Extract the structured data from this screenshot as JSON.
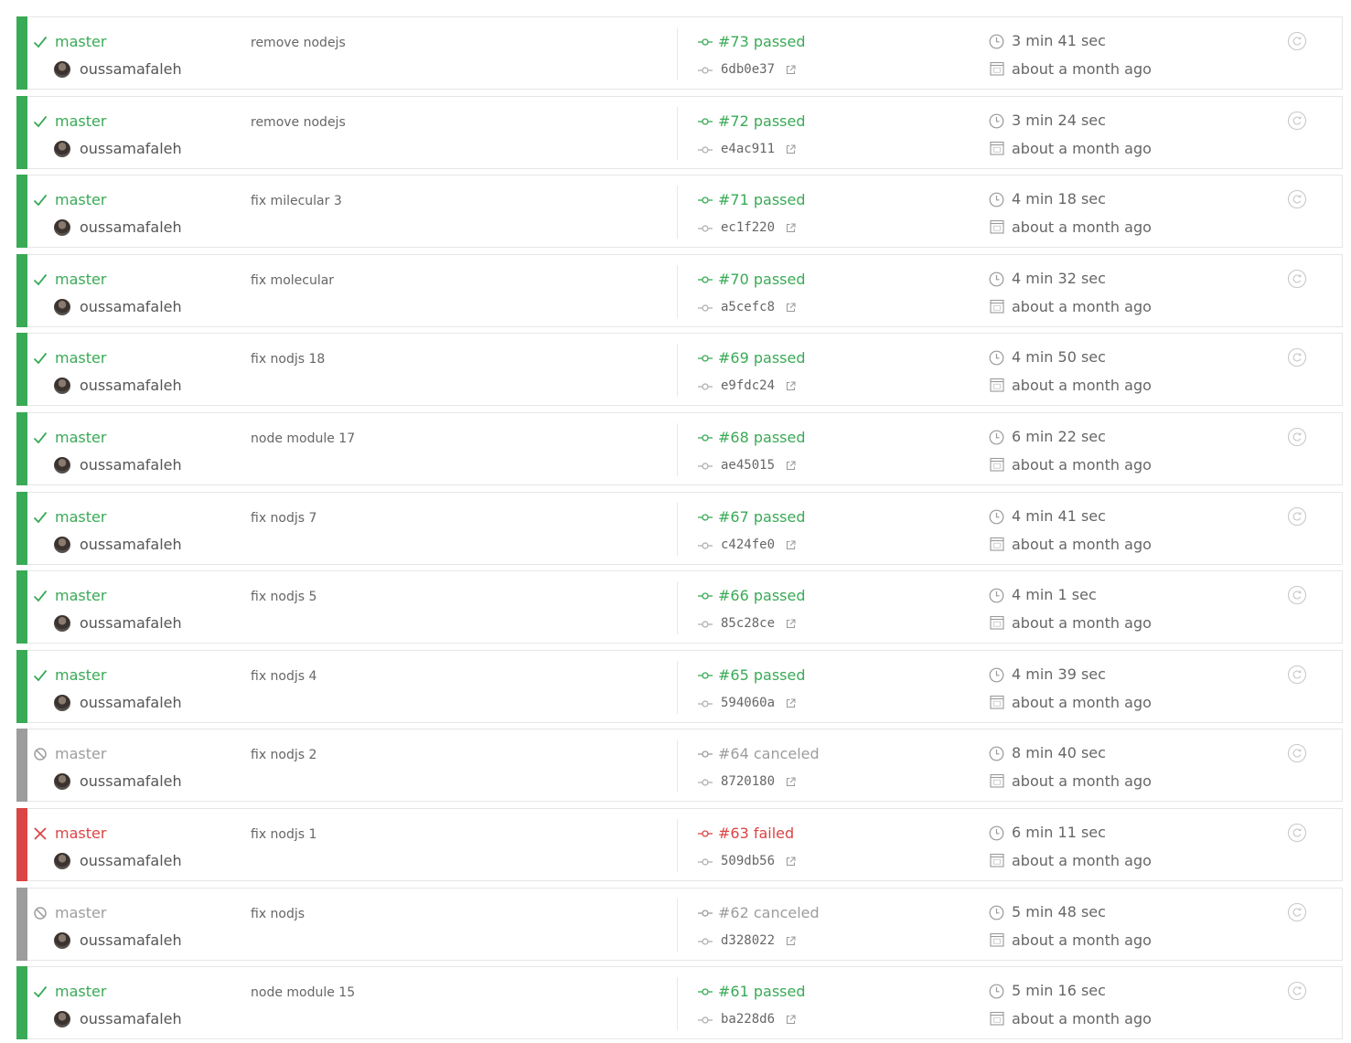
{
  "colors": {
    "passed": "#39aa56",
    "failed": "#db4545",
    "canceled": "#9d9d9d"
  },
  "builds": [
    {
      "state": "passed",
      "branch": "master",
      "author": "oussamafaleh",
      "message": "remove nodejs",
      "build": "#73 passed",
      "sha": "6db0e37",
      "duration": "3 min 41 sec",
      "finished": "about a month ago"
    },
    {
      "state": "passed",
      "branch": "master",
      "author": "oussamafaleh",
      "message": "remove nodejs",
      "build": "#72 passed",
      "sha": "e4ac911",
      "duration": "3 min 24 sec",
      "finished": "about a month ago"
    },
    {
      "state": "passed",
      "branch": "master",
      "author": "oussamafaleh",
      "message": "fix milecular 3",
      "build": "#71 passed",
      "sha": "ec1f220",
      "duration": "4 min 18 sec",
      "finished": "about a month ago"
    },
    {
      "state": "passed",
      "branch": "master",
      "author": "oussamafaleh",
      "message": "fix molecular",
      "build": "#70 passed",
      "sha": "a5cefc8",
      "duration": "4 min 32 sec",
      "finished": "about a month ago"
    },
    {
      "state": "passed",
      "branch": "master",
      "author": "oussamafaleh",
      "message": "fix nodjs 18",
      "build": "#69 passed",
      "sha": "e9fdc24",
      "duration": "4 min 50 sec",
      "finished": "about a month ago"
    },
    {
      "state": "passed",
      "branch": "master",
      "author": "oussamafaleh",
      "message": "node module 17",
      "build": "#68 passed",
      "sha": "ae45015",
      "duration": "6 min 22 sec",
      "finished": "about a month ago"
    },
    {
      "state": "passed",
      "branch": "master",
      "author": "oussamafaleh",
      "message": "fix nodjs 7",
      "build": "#67 passed",
      "sha": "c424fe0",
      "duration": "4 min 41 sec",
      "finished": "about a month ago"
    },
    {
      "state": "passed",
      "branch": "master",
      "author": "oussamafaleh",
      "message": "fix nodjs 5",
      "build": "#66 passed",
      "sha": "85c28ce",
      "duration": "4 min 1 sec",
      "finished": "about a month ago"
    },
    {
      "state": "passed",
      "branch": "master",
      "author": "oussamafaleh",
      "message": "fix nodjs 4",
      "build": "#65 passed",
      "sha": "594060a",
      "duration": "4 min 39 sec",
      "finished": "about a month ago"
    },
    {
      "state": "canceled",
      "branch": "master",
      "author": "oussamafaleh",
      "message": "fix nodjs 2",
      "build": "#64 canceled",
      "sha": "8720180",
      "duration": "8 min 40 sec",
      "finished": "about a month ago"
    },
    {
      "state": "failed",
      "branch": "master",
      "author": "oussamafaleh",
      "message": "fix nodjs 1",
      "build": "#63 failed",
      "sha": "509db56",
      "duration": "6 min 11 sec",
      "finished": "about a month ago"
    },
    {
      "state": "canceled",
      "branch": "master",
      "author": "oussamafaleh",
      "message": "fix nodjs",
      "build": "#62 canceled",
      "sha": "d328022",
      "duration": "5 min 48 sec",
      "finished": "about a month ago"
    },
    {
      "state": "passed",
      "branch": "master",
      "author": "oussamafaleh",
      "message": "node module 15",
      "build": "#61 passed",
      "sha": "ba228d6",
      "duration": "5 min 16 sec",
      "finished": "about a month ago"
    }
  ]
}
